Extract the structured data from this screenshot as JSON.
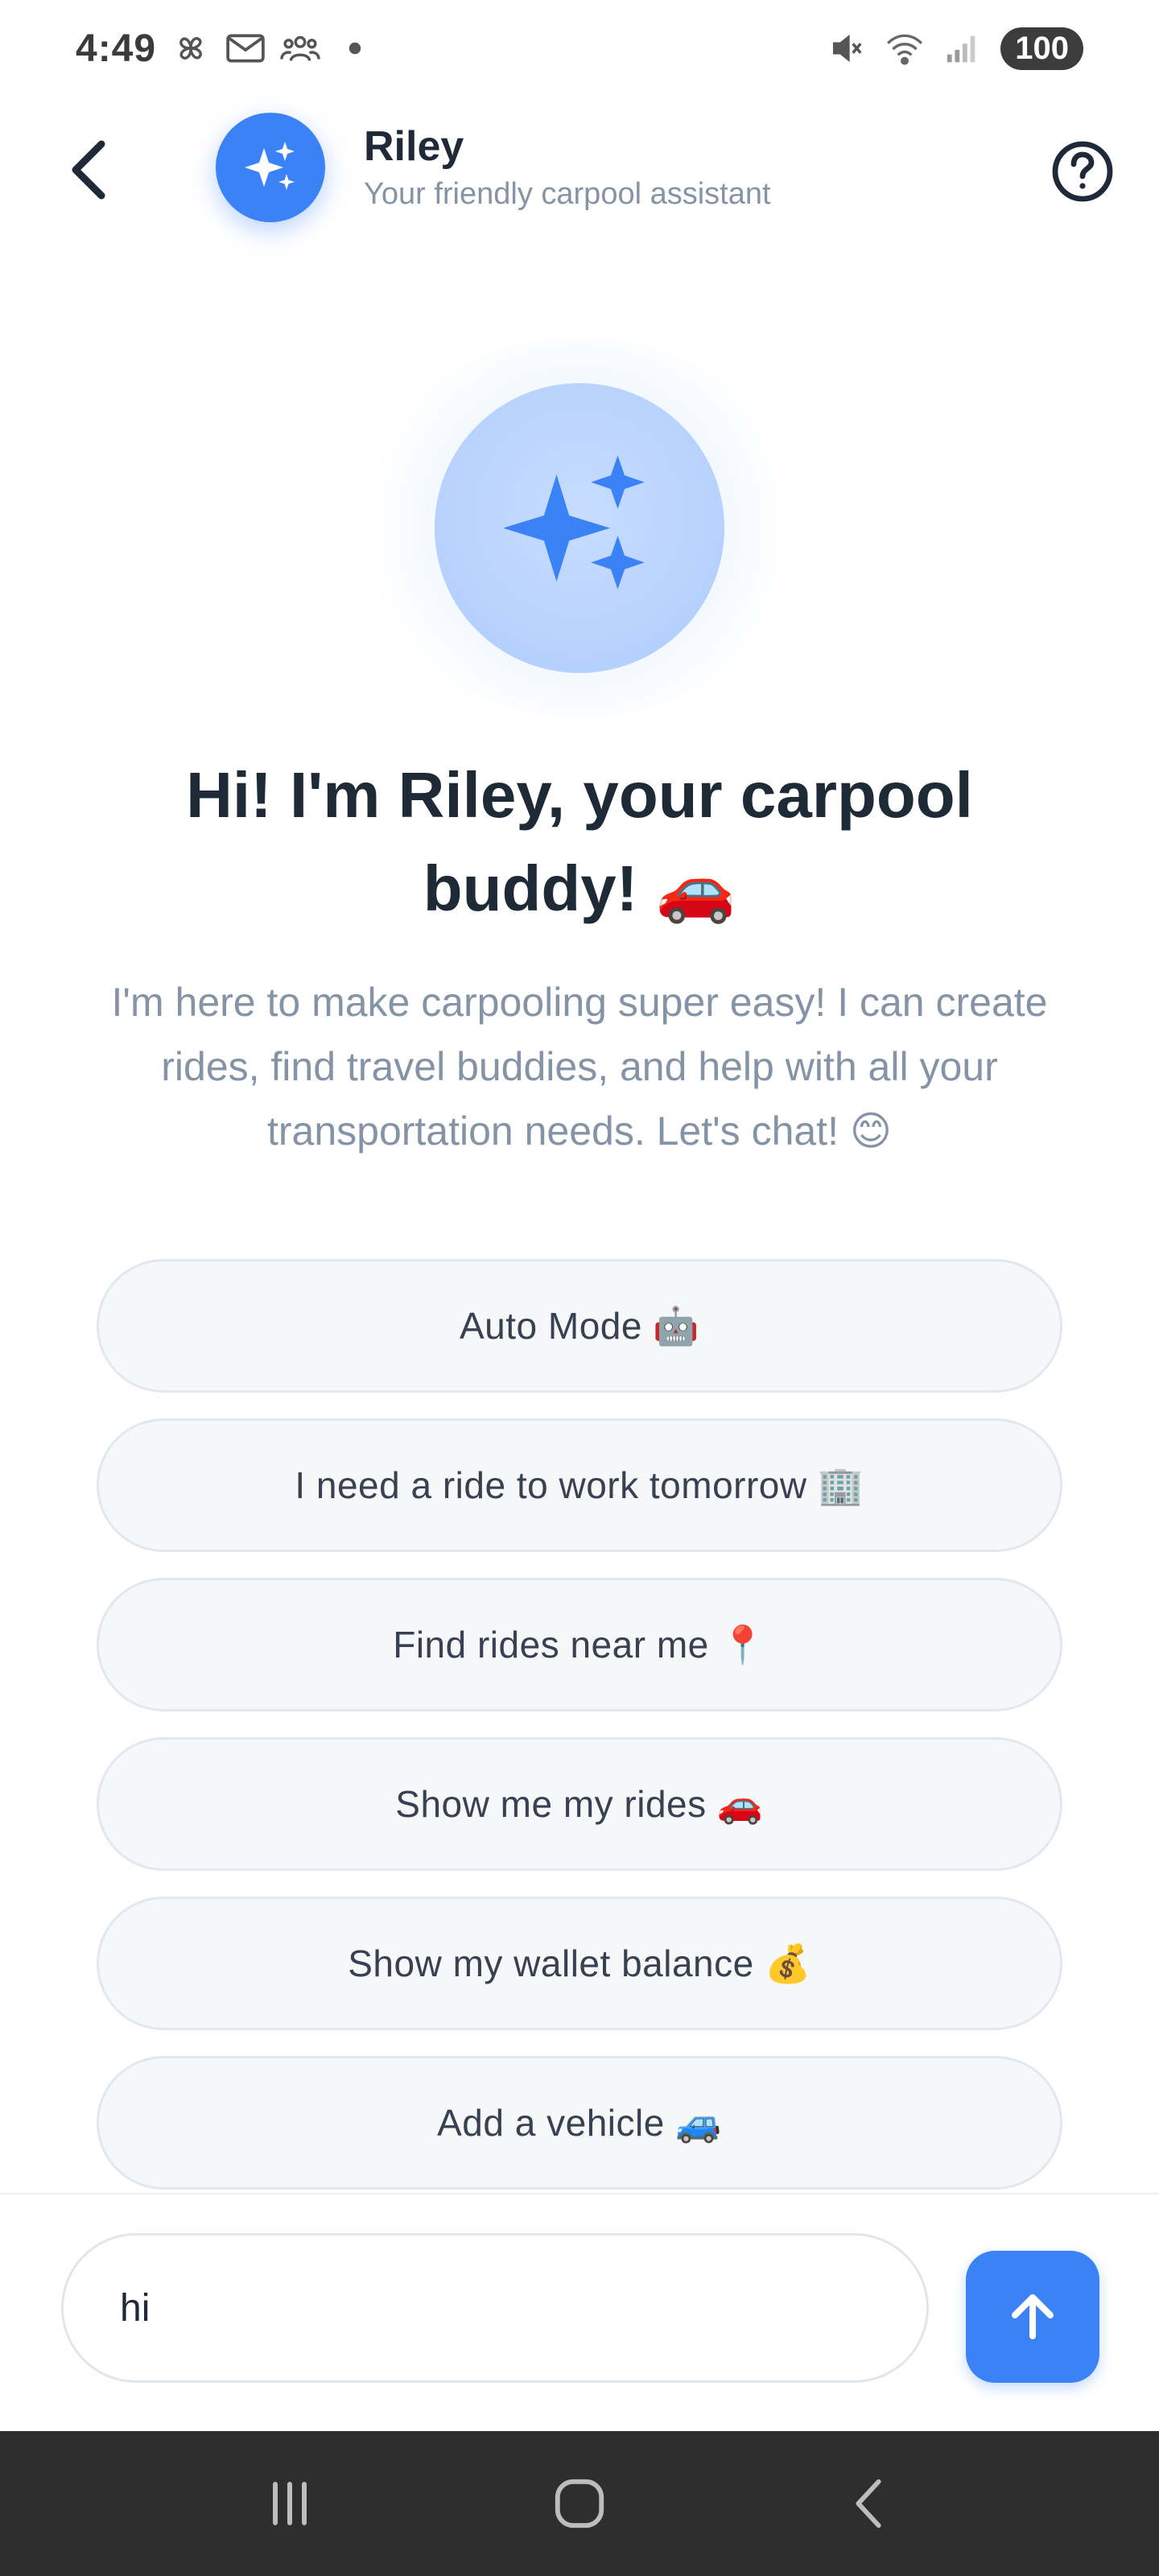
{
  "status_bar": {
    "time": "4:49",
    "battery": "100",
    "left_icons": [
      "pinwheel-icon",
      "gmail-icon",
      "people-icon",
      "dot-icon"
    ],
    "right_icons": [
      "mute-icon",
      "wifi-icon",
      "signal-icon"
    ]
  },
  "header": {
    "title": "Riley",
    "subtitle": "Your friendly carpool assistant"
  },
  "hero": {
    "title": "Hi! I'm Riley, your carpool buddy! 🚗",
    "description": "I'm here to make carpooling super easy! I can create rides, find travel buddies, and help with all your transportation needs. Let's chat! 😊"
  },
  "suggestions": [
    "Auto Mode 🤖",
    "I need a ride to work tomorrow 🏢",
    "Find rides near me 📍",
    "Show me my rides 🚗",
    "Show my wallet balance 💰",
    "Add a vehicle 🚙"
  ],
  "input": {
    "value": "hi"
  },
  "colors": {
    "accent": "#3b82f6",
    "nav_background": "#2e2e2e"
  }
}
